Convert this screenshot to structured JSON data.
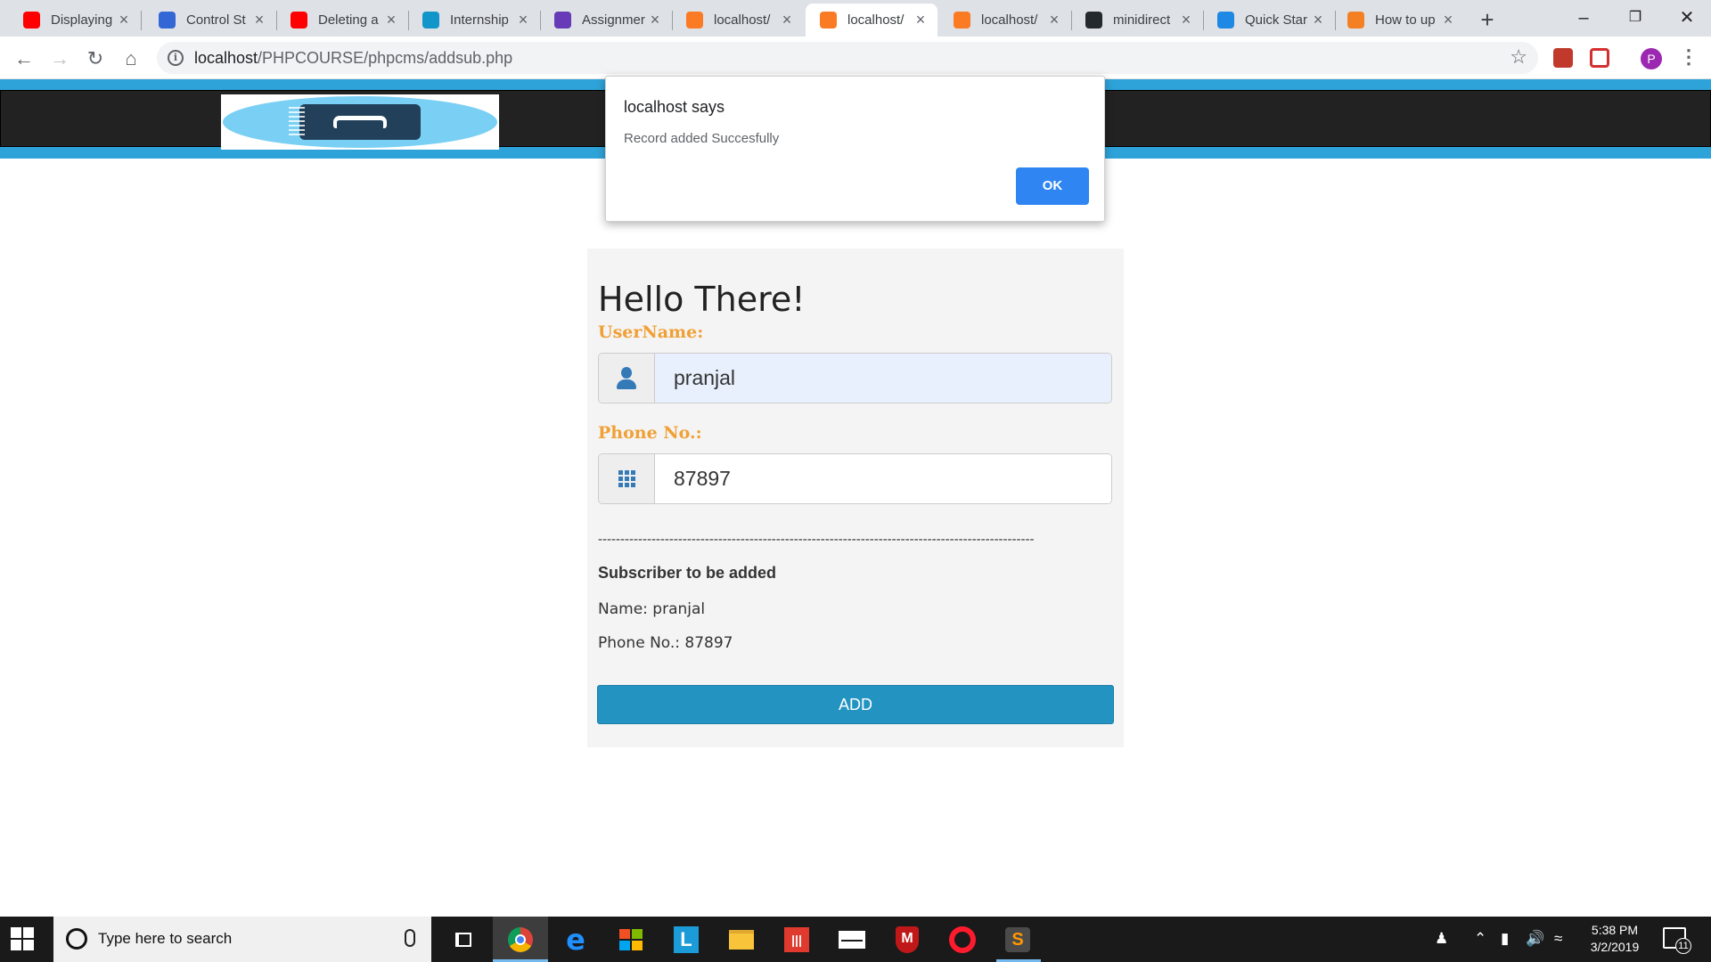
{
  "browser": {
    "tabs": [
      {
        "label": "Displaying",
        "icon": "youtube-icon",
        "color": "#ff0000"
      },
      {
        "label": "Control St",
        "icon": "infinity-icon",
        "color": "#3367d6"
      },
      {
        "label": "Deleting a",
        "icon": "youtube-icon",
        "color": "#ff0000"
      },
      {
        "label": "Internship",
        "icon": "internshala-icon",
        "color": "#1295c9"
      },
      {
        "label": "Assignmer",
        "icon": "forms-icon",
        "color": "#673ab7"
      },
      {
        "label": "localhost/",
        "icon": "xampp-icon",
        "color": "#fb7a24"
      },
      {
        "label": "localhost/",
        "icon": "xampp-icon",
        "color": "#fb7a24"
      },
      {
        "label": "localhost/",
        "icon": "xampp-icon",
        "color": "#fb7a24"
      },
      {
        "label": "minidirect",
        "icon": "github-icon",
        "color": "#24292e"
      },
      {
        "label": "Quick Star",
        "icon": "bootstrap-icon",
        "color": "#1e88e5"
      },
      {
        "label": "How to up",
        "icon": "stackoverflow-icon",
        "color": "#f48024"
      }
    ],
    "active_tab": 6,
    "url_host": "localhost",
    "url_path": "/PHPCOURSE/phpcms/addsub.php",
    "profile_initial": "P"
  },
  "dialog": {
    "title": "localhost says",
    "message": "Record added Succesfully",
    "ok_label": "OK"
  },
  "form": {
    "greeting": "Hello There!",
    "username_label": "UserName:",
    "username_value": "pranjal",
    "phone_label": "Phone No.:",
    "phone_value": "87897",
    "divider": "--------------------------------------------------------------------------------------------------",
    "summary_title": "Subscriber to be added",
    "summary_name": "Name: pranjal",
    "summary_phone": "Phone No.: 87897",
    "add_label": "ADD"
  },
  "taskbar": {
    "search_placeholder": "Type here to search",
    "time": "5:38 PM",
    "date": "3/2/2019",
    "notification_count": "11"
  },
  "colors": {
    "header_accent": "#2ea3d9",
    "label_orange": "#f0a035",
    "button_blue": "#2394c2",
    "ok_blue": "#2f85f1"
  }
}
